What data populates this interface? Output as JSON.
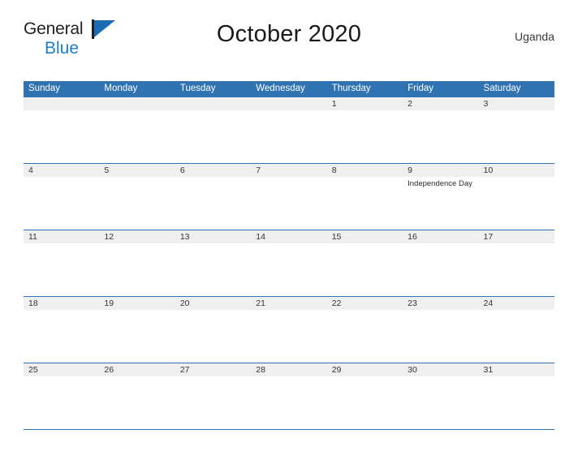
{
  "brand": {
    "name_part1": "General",
    "name_part2": "Blue",
    "mark_icon": "flag-triangle-icon",
    "accent_color": "#1b7ecb",
    "mark_color": "#1b6cb3"
  },
  "header": {
    "title": "October 2020",
    "country": "Uganda"
  },
  "colors": {
    "header_blue": "#2f73b3",
    "date_band_gray": "#efefef",
    "text_dark": "#333333",
    "white": "#ffffff"
  },
  "calendar": {
    "month": "October",
    "year": "2020",
    "weekday_headers": [
      "Sunday",
      "Monday",
      "Tuesday",
      "Wednesday",
      "Thursday",
      "Friday",
      "Saturday"
    ],
    "weeks": [
      {
        "days": [
          {
            "number": "",
            "event": ""
          },
          {
            "number": "",
            "event": ""
          },
          {
            "number": "",
            "event": ""
          },
          {
            "number": "",
            "event": ""
          },
          {
            "number": "1",
            "event": ""
          },
          {
            "number": "2",
            "event": ""
          },
          {
            "number": "3",
            "event": ""
          }
        ]
      },
      {
        "days": [
          {
            "number": "4",
            "event": ""
          },
          {
            "number": "5",
            "event": ""
          },
          {
            "number": "6",
            "event": ""
          },
          {
            "number": "7",
            "event": ""
          },
          {
            "number": "8",
            "event": ""
          },
          {
            "number": "9",
            "event": "Independence Day"
          },
          {
            "number": "10",
            "event": ""
          }
        ]
      },
      {
        "days": [
          {
            "number": "11",
            "event": ""
          },
          {
            "number": "12",
            "event": ""
          },
          {
            "number": "13",
            "event": ""
          },
          {
            "number": "14",
            "event": ""
          },
          {
            "number": "15",
            "event": ""
          },
          {
            "number": "16",
            "event": ""
          },
          {
            "number": "17",
            "event": ""
          }
        ]
      },
      {
        "days": [
          {
            "number": "18",
            "event": ""
          },
          {
            "number": "19",
            "event": ""
          },
          {
            "number": "20",
            "event": ""
          },
          {
            "number": "21",
            "event": ""
          },
          {
            "number": "22",
            "event": ""
          },
          {
            "number": "23",
            "event": ""
          },
          {
            "number": "24",
            "event": ""
          }
        ]
      },
      {
        "days": [
          {
            "number": "25",
            "event": ""
          },
          {
            "number": "26",
            "event": ""
          },
          {
            "number": "27",
            "event": ""
          },
          {
            "number": "28",
            "event": ""
          },
          {
            "number": "29",
            "event": ""
          },
          {
            "number": "30",
            "event": ""
          },
          {
            "number": "31",
            "event": ""
          }
        ]
      }
    ]
  }
}
